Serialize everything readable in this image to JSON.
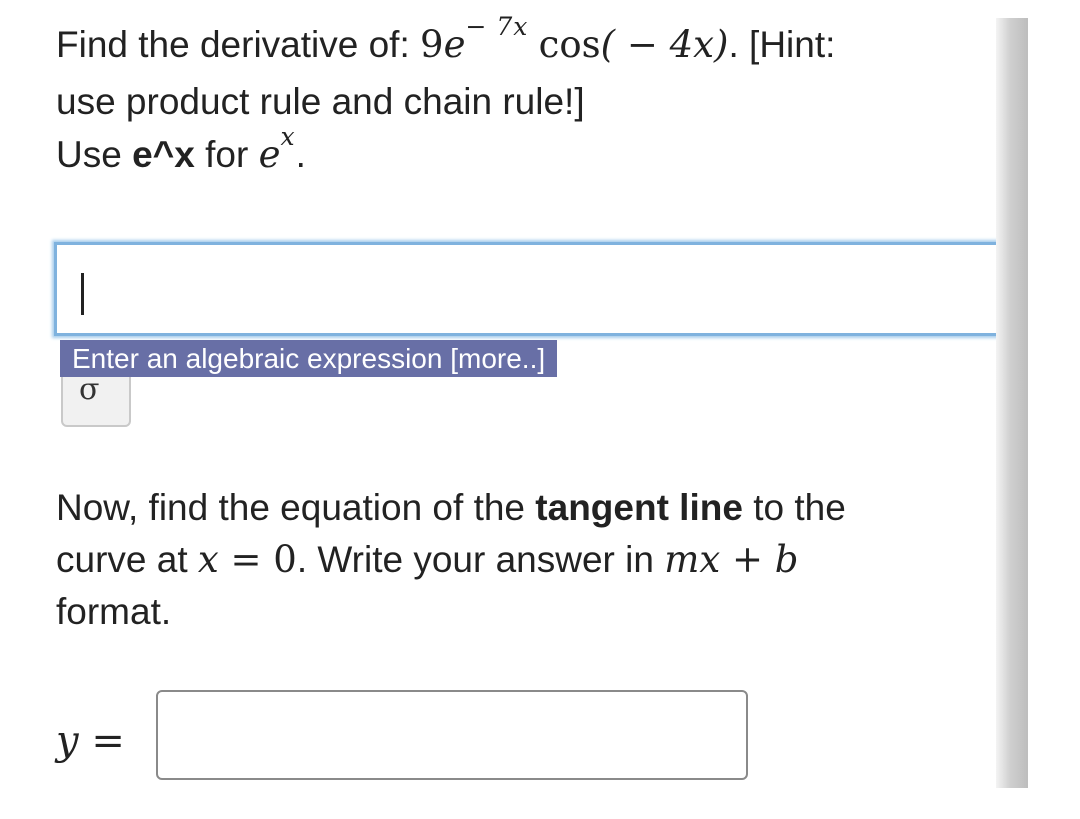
{
  "question1": {
    "lead": "Find the derivative of: ",
    "coef": "9",
    "base": "e",
    "exponent": "− 7x",
    "cos_fn": "cos",
    "cos_arg": "( − 4x)",
    "period": ". ",
    "hint_a": "[Hint:",
    "hint_b": "use product rule and chain rule!]",
    "use_prefix": "Use ",
    "use_bold": "e^x",
    "use_mid": " for ",
    "use_math_base": "e",
    "use_math_exp": "x",
    "use_end": "."
  },
  "answer1": {
    "value": ""
  },
  "symbol_button": {
    "glyph": "σ"
  },
  "tooltip": {
    "text": "Enter an algebraic expression [more..]"
  },
  "question2": {
    "part1": "Now, find the equation of the ",
    "bold": "tangent line",
    "part2": " to the",
    "part3": "curve at ",
    "math_x": "x",
    "equals": " = 0",
    "part4": ". Write your answer in ",
    "math_mx": "mx",
    "plus": " + ",
    "math_b": "b",
    "part5": "format."
  },
  "answer2": {
    "label_var": "y",
    "label_eq": " =",
    "value": ""
  }
}
